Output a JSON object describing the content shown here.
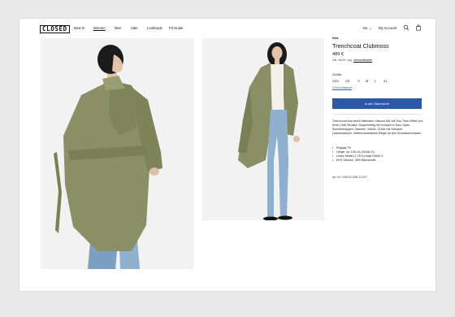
{
  "brand": {
    "logo": "CLOSED"
  },
  "nav": {
    "items": [
      {
        "label": "New In"
      },
      {
        "label": "Women",
        "active": true
      },
      {
        "label": "Men"
      },
      {
        "label": "Sale"
      },
      {
        "label": "Lookbook"
      },
      {
        "label": "Fit Guide"
      }
    ],
    "language": "De",
    "account": "My Account",
    "icons": [
      "search-icon",
      "bag-icon"
    ]
  },
  "images": [
    {
      "subject": "back view of olive trench coat"
    },
    {
      "subject": "front view of olive trench coat with jeans"
    }
  ],
  "product": {
    "tag": "New",
    "title": "Trenchcoat Clubmoss",
    "price": "489 €",
    "tax_prefix": "inkl. MwSt. zzgl.",
    "tax_link": "Versandkosten",
    "size_label": "Größe",
    "sizes": [
      "XXS",
      "XS",
      "S",
      "M",
      "L",
      "XL"
    ],
    "size_guide": "Größentabelle",
    "add_to_cart": "In den Warenkorb",
    "description": "Trenchcoat aus weich fallendem Viskose-Mix mit Two-Tone-Effekt und feiner Twill-Struktur. Doppelreihig mit Knöpfen in Horn-Optik, Schulterklappen, Taschen, Schlitz, Gürtel mit Schlaufe, Leistentaschen. Weitenverstellbare Riegel an den Ärmelabschlüssen.",
    "bullets": [
      "Regular Fit",
      "Länge: ca. 106 cm (Größe S)",
      "Unser Model (1.78 m) trägt Größe S",
      "60% Viskose, 38% Baumwolle"
    ],
    "article": "Art.-Nr. C95103-0RB-22-947"
  },
  "colors": {
    "coat": "#8a8f66",
    "accent": "#2d57a7",
    "jeans": "#8fb0cf"
  }
}
